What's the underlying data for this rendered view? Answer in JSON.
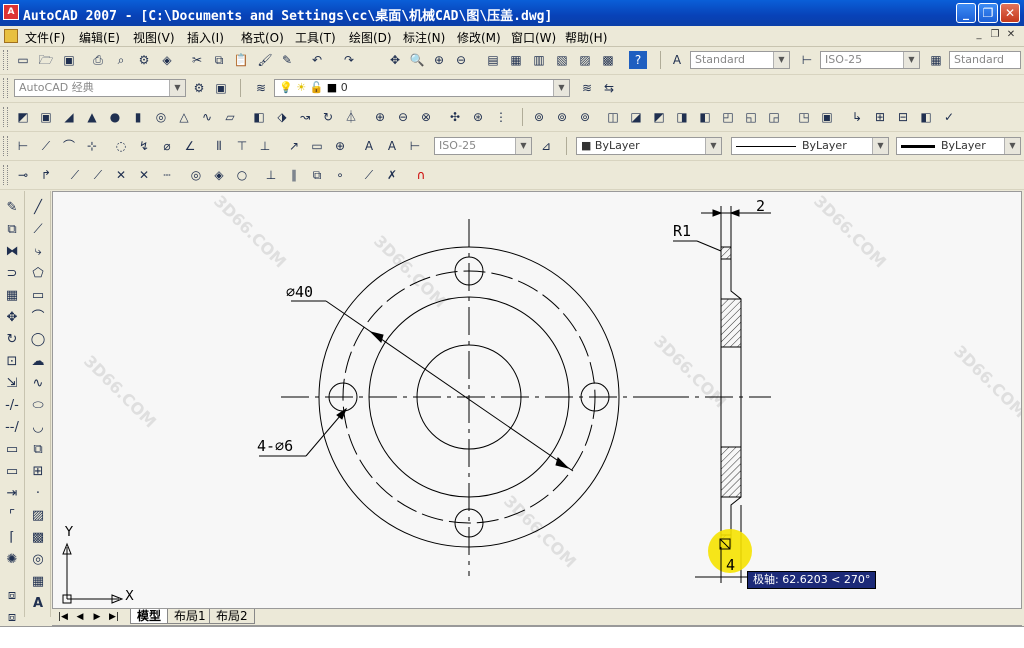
{
  "window": {
    "title": "AutoCAD 2007 - [C:\\Documents and Settings\\cc\\桌面\\机械CAD\\图\\压盖.dwg]",
    "app_icon_text": "A",
    "min_label": "_",
    "max_label": "❐",
    "close_label": "✕"
  },
  "menu": [
    "文件(F)",
    "编辑(E)",
    "视图(V)",
    "插入(I)",
    "格式(O)",
    "工具(T)",
    "绘图(D)",
    "标注(N)",
    "修改(M)",
    "窗口(W)",
    "帮助(H)"
  ],
  "toolbars": {
    "text_style": "Standard",
    "dim_style": "ISO-25",
    "table_style": "Standard",
    "workspace": "AutoCAD 经典",
    "layer": "0",
    "dim_style_2": "ISO-25",
    "color": "ByLayer",
    "linetype": "ByLayer",
    "lineweight": "ByLayer"
  },
  "drawing": {
    "dim_diameter": "⌀40",
    "dim_holes": "4-⌀6",
    "dim_radius": "R1",
    "dim_thickness": "2",
    "dim_bottom": "4",
    "ucs_x": "X",
    "ucs_y": "Y",
    "watermark": "3D66.COM"
  },
  "tooltip": "极轴: 62.6203 < 270°",
  "tabs": [
    "模型",
    "布局1",
    "布局2"
  ],
  "colors": {
    "titlebar": "#0a4fc8",
    "canvas": "#f7f7f7",
    "tooltip": "#1c2a78",
    "cursor": "#f5e200"
  }
}
